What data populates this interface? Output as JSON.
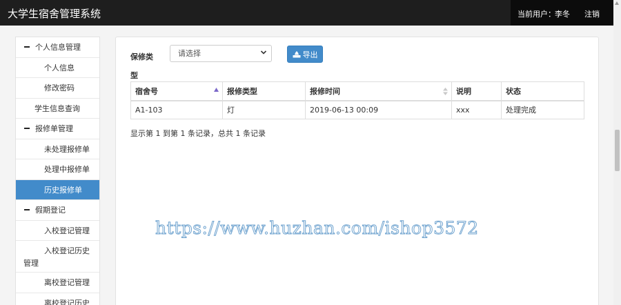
{
  "header": {
    "app_title": "大学生宿舍管理系统",
    "user_prefix": "当前用户：",
    "user_name": "李冬",
    "logout_label": "注销"
  },
  "sidebar": {
    "group_personal": "个人信息管理",
    "personal_info": "个人信息",
    "change_password": "修改密码",
    "student_query": "学生信息查询",
    "group_repair": "报修单管理",
    "repair_pending": "未处理报修单",
    "repair_processing": "处理中报修单",
    "repair_history": "历史报修单",
    "group_holiday": "假期登记",
    "enroll_manage": "入校登记管理",
    "enroll_history_1": "入校登记历史",
    "enroll_history_2": "管理",
    "leave_manage": "离校登记管理",
    "leave_history_1": "离校登记历史"
  },
  "filter": {
    "label": "保修类型",
    "select_value": "请选择",
    "export_label": "导出"
  },
  "table": {
    "headers": [
      "宿舍号",
      "报修类型",
      "报修时间",
      "说明",
      "状态"
    ],
    "rows": [
      [
        "A1-103",
        "灯",
        "2019-06-13 00:09",
        "xxx",
        "处理完成"
      ]
    ]
  },
  "pager_info": "显示第 1 到第 1 条记录，总共 1 条记录",
  "watermark": "https://www.huzhan.com/ishop3572",
  "colors": {
    "topbar": "#1e1e1e",
    "accent": "#428bca"
  }
}
